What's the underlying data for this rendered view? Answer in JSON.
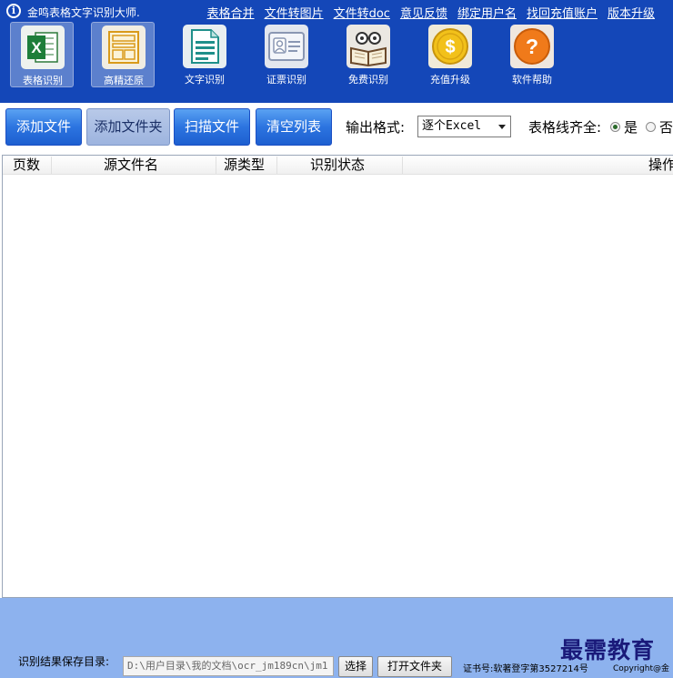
{
  "header": {
    "app_title": "金鸣表格文字识别大师.",
    "links": [
      "表格合并",
      "文件转图片",
      "文件转doc",
      "意见反馈",
      "绑定用户名",
      "找回充值账户",
      "版本升级"
    ]
  },
  "toolbar": {
    "tools": [
      {
        "label": "表格识别",
        "icon": "excel-icon",
        "active": true
      },
      {
        "label": "高精还原",
        "icon": "layout-icon",
        "active": true
      },
      {
        "label": "文字识别",
        "icon": "document-icon",
        "active": false
      },
      {
        "label": "证票识别",
        "icon": "id-card-icon",
        "active": false
      },
      {
        "label": "免费识别",
        "icon": "reading-icon",
        "active": false
      },
      {
        "label": "充值升级",
        "icon": "coin-icon",
        "active": false
      },
      {
        "label": "软件帮助",
        "icon": "help-icon",
        "active": false
      }
    ]
  },
  "actions": {
    "add_file": "添加文件",
    "add_folder": "添加文件夹",
    "scan_file": "扫描文件",
    "clear_list": "清空列表",
    "format_label": "输出格式:",
    "format_value": "逐个Excel",
    "align_label": "表格线齐全:",
    "align_yes": "是",
    "align_no": "否",
    "align_selected": "是"
  },
  "table": {
    "columns": [
      "页数",
      "源文件名",
      "源类型",
      "识别状态",
      "操作"
    ],
    "rows": []
  },
  "footer": {
    "save_label": "识别结果保存目录:",
    "save_path": "D:\\用户目录\\我的文档\\ocr_jm189cn\\jm1",
    "choose_btn": "选择",
    "open_folder_btn": "打开文件夹",
    "cert_text": "证书号:软著登字第3527214号",
    "copyright": "Copyright@金",
    "watermark": "最需教育"
  },
  "colors": {
    "header_bg": "#1447b8",
    "footer_bg": "#8db2ee",
    "button_blue": "#2c74e0"
  }
}
